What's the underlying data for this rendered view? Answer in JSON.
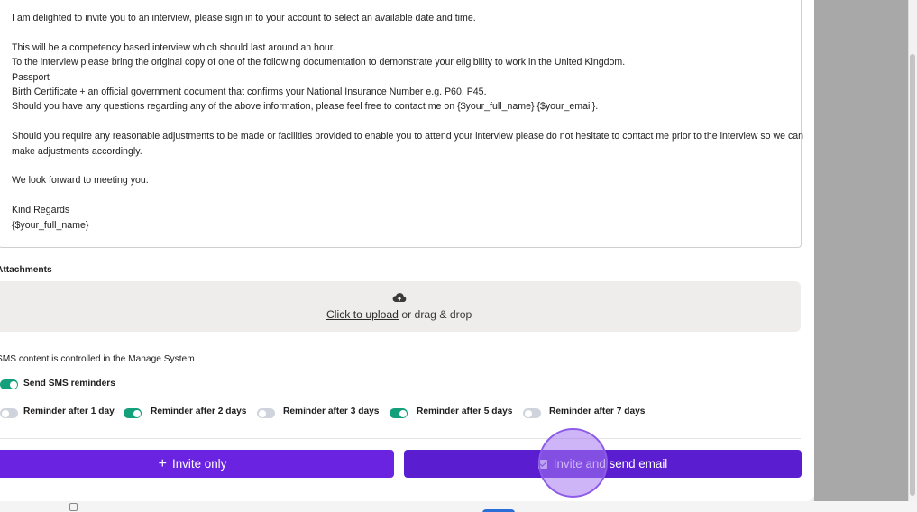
{
  "message": {
    "lines": [
      "I am delighted to invite you to an interview, please sign in to your account to select an available date and time.",
      "",
      "This will be a competency based interview which should last around an hour.",
      "To the interview please bring the original copy of one of the following documentation to demonstrate your eligibility to work in the United Kingdom.",
      "Passport",
      "Birth Certificate + an official government document that confirms your National Insurance Number e.g. P60, P45.",
      "Should you have any questions regarding any of the above information, please feel free to contact me on {$your_full_name} {$your_email}.",
      "",
      "Should you require any reasonable adjustments to be made or facilities provided to enable you to attend your interview please do not hesitate to contact me prior to the interview so we can",
      "make adjustments accordingly.",
      "",
      "We look forward to meeting you.",
      "",
      "Kind Regards",
      "{$your_full_name}"
    ]
  },
  "attachments": {
    "label": "Attachments",
    "upload_link": "Click to upload",
    "upload_rest": " or drag & drop",
    "icon": "cloud-upload-icon"
  },
  "sms": {
    "note": "SMS content is controlled in the Manage System",
    "send_reminders": {
      "label": "Send SMS reminders",
      "on": true
    },
    "reminders": [
      {
        "label": "Reminder after 1 day",
        "on": false
      },
      {
        "label": "Reminder after 2 days",
        "on": true
      },
      {
        "label": "Reminder after 3 days",
        "on": false
      },
      {
        "label": "Reminder after 5 days",
        "on": true
      },
      {
        "label": "Reminder after 7 days",
        "on": false
      }
    ]
  },
  "actions": {
    "invite_only": "Invite only",
    "invite_send_email": "Invite and send email"
  },
  "colors": {
    "primary": "#6a23e0",
    "toggle_on": "#13a07a",
    "toggle_off": "#cfd4dc"
  }
}
